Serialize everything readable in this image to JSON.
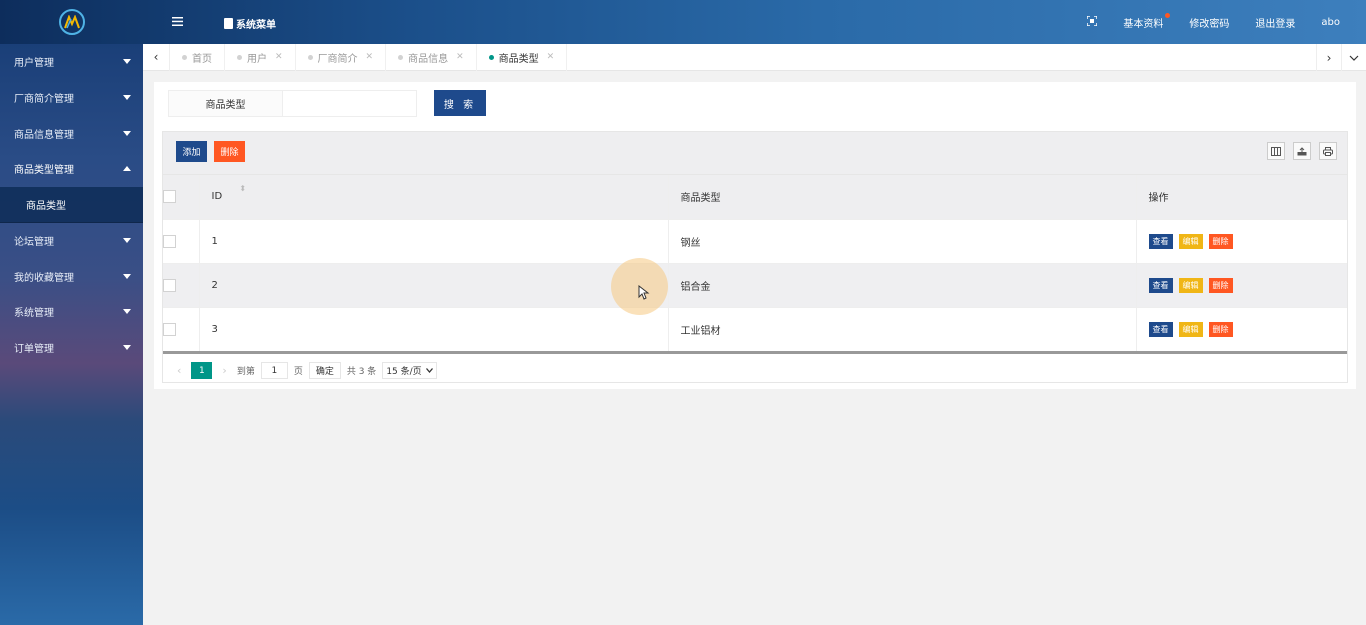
{
  "header": {
    "sys_menu": "系统菜单",
    "right_items": [
      "基本资料",
      "修改密码",
      "退出登录",
      "abo"
    ]
  },
  "sidebar": {
    "items": [
      {
        "label": "用户管理",
        "expanded": false
      },
      {
        "label": "厂商简介管理",
        "expanded": false
      },
      {
        "label": "商品信息管理",
        "expanded": false
      },
      {
        "label": "商品类型管理",
        "expanded": true,
        "sub": "商品类型"
      },
      {
        "label": "论坛管理",
        "expanded": false
      },
      {
        "label": "我的收藏管理",
        "expanded": false
      },
      {
        "label": "系统管理",
        "expanded": false
      },
      {
        "label": "订单管理",
        "expanded": false
      }
    ]
  },
  "tabs": [
    {
      "label": "首页",
      "closable": false,
      "active": false
    },
    {
      "label": "用户",
      "closable": true,
      "active": false
    },
    {
      "label": "厂商简介",
      "closable": true,
      "active": false
    },
    {
      "label": "商品信息",
      "closable": true,
      "active": false
    },
    {
      "label": "商品类型",
      "closable": true,
      "active": true
    }
  ],
  "search": {
    "label": "商品类型",
    "value": "",
    "button": "搜 索"
  },
  "toolbar": {
    "add": "添加",
    "delete": "删除"
  },
  "table": {
    "columns": [
      "ID",
      "商品类型",
      "操作"
    ],
    "rows": [
      {
        "id": "1",
        "type": "钢丝"
      },
      {
        "id": "2",
        "type": "铝合金"
      },
      {
        "id": "3",
        "type": "工业铝材"
      }
    ],
    "ops": {
      "view": "查看",
      "edit": "编辑",
      "remove": "删除"
    }
  },
  "pager": {
    "current": "1",
    "goto_label": "到第",
    "goto_value": "1",
    "page_unit": "页",
    "confirm": "确定",
    "total": "共 3 条",
    "page_size": "15 条/页"
  },
  "colors": {
    "primary": "#1e4a8c",
    "danger": "#ff5722",
    "warn": "#f0b616",
    "teal": "#009688"
  }
}
